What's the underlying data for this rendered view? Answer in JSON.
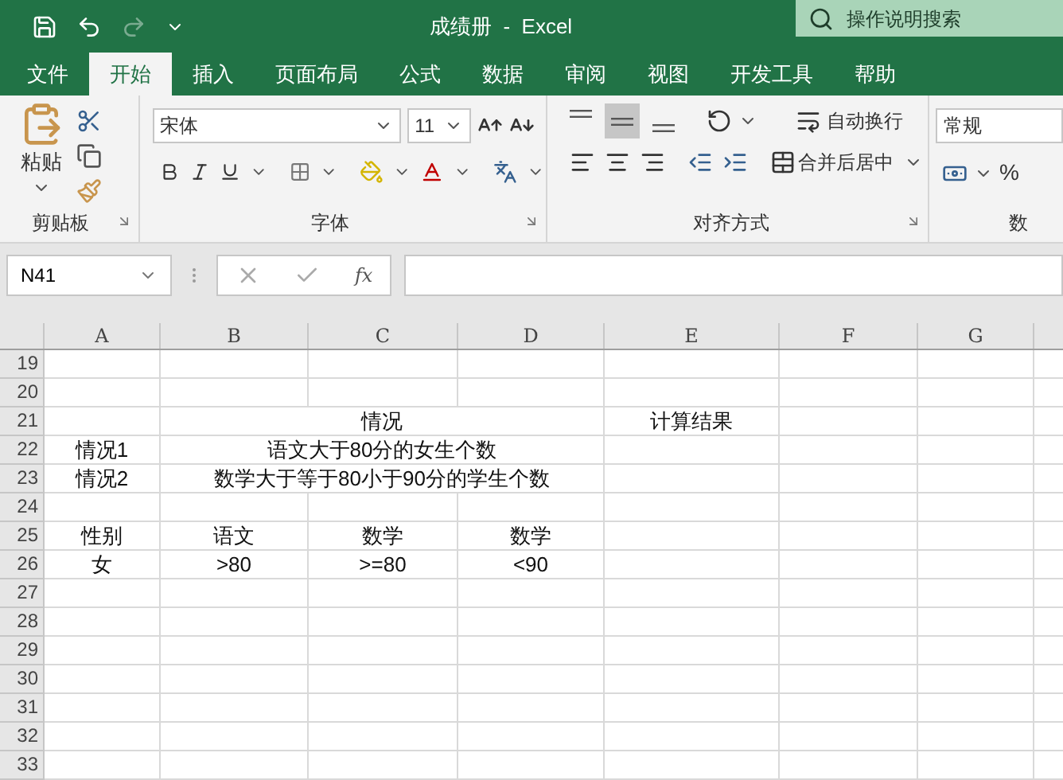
{
  "title_bar": {
    "title": "成绩册  -  Excel",
    "search": {
      "placeholder": "操作说明搜索"
    }
  },
  "tabs": [
    {
      "label": "文件",
      "selected": false
    },
    {
      "label": "开始",
      "selected": true
    },
    {
      "label": "插入",
      "selected": false
    },
    {
      "label": "页面布局",
      "selected": false
    },
    {
      "label": "公式",
      "selected": false
    },
    {
      "label": "数据",
      "selected": false
    },
    {
      "label": "审阅",
      "selected": false
    },
    {
      "label": "视图",
      "selected": false
    },
    {
      "label": "开发工具",
      "selected": false
    },
    {
      "label": "帮助",
      "selected": false
    }
  ],
  "ribbon": {
    "clipboard": {
      "paste": "粘贴",
      "label": "剪贴板"
    },
    "font": {
      "font_name": "宋体",
      "font_size": "11",
      "label": "字体"
    },
    "alignment": {
      "vertical": [
        {
          "kind": "top",
          "selected": false
        },
        {
          "kind": "middle",
          "selected": true
        },
        {
          "kind": "bottom",
          "selected": false
        }
      ],
      "wrap_text": "自动换行",
      "merge": "合并后居中",
      "label": "对齐方式"
    },
    "number": {
      "format": "常规",
      "percent": "%",
      "label": "数"
    }
  },
  "formula_bar": {
    "name_box": "N41",
    "function": "fx"
  },
  "sheet": {
    "columns": [
      "A",
      "B",
      "C",
      "D",
      "E",
      "F",
      "G"
    ],
    "rows": [
      {
        "number": "19",
        "cells": []
      },
      {
        "number": "20",
        "cells": []
      },
      {
        "number": "21",
        "cells": [
          {
            "kind": "single",
            "text": ""
          },
          {
            "kind": "merged",
            "text": "情况"
          },
          {
            "kind": "covered",
            "text": ""
          },
          {
            "kind": "covered",
            "text": ""
          },
          {
            "kind": "single",
            "text": "计算结果"
          }
        ]
      },
      {
        "number": "22",
        "cells": [
          {
            "kind": "single",
            "text": "情况1"
          },
          {
            "kind": "merged",
            "text": "语文大于80分的女生个数"
          }
        ]
      },
      {
        "number": "23",
        "cells": [
          {
            "kind": "single",
            "text": "情况2"
          },
          {
            "kind": "merged",
            "text": "数学大于等于80小于90分的学生个数"
          }
        ]
      },
      {
        "number": "24",
        "cells": []
      },
      {
        "number": "25",
        "cells": [
          {
            "kind": "single",
            "text": "性别"
          },
          {
            "kind": "single",
            "text": "语文"
          },
          {
            "kind": "single",
            "text": "数学"
          },
          {
            "kind": "single",
            "text": "数学"
          }
        ]
      },
      {
        "number": "26",
        "cells": [
          {
            "kind": "single",
            "text": "女"
          },
          {
            "kind": "single",
            "text": ">80"
          },
          {
            "kind": "single",
            "text": ">=80"
          },
          {
            "kind": "single",
            "text": "<90"
          }
        ]
      },
      {
        "number": "27",
        "cells": []
      },
      {
        "number": "28",
        "cells": []
      },
      {
        "number": "29",
        "cells": []
      },
      {
        "number": "30",
        "cells": []
      },
      {
        "number": "31",
        "cells": []
      },
      {
        "number": "32",
        "cells": []
      },
      {
        "number": "33",
        "cells": []
      }
    ]
  }
}
